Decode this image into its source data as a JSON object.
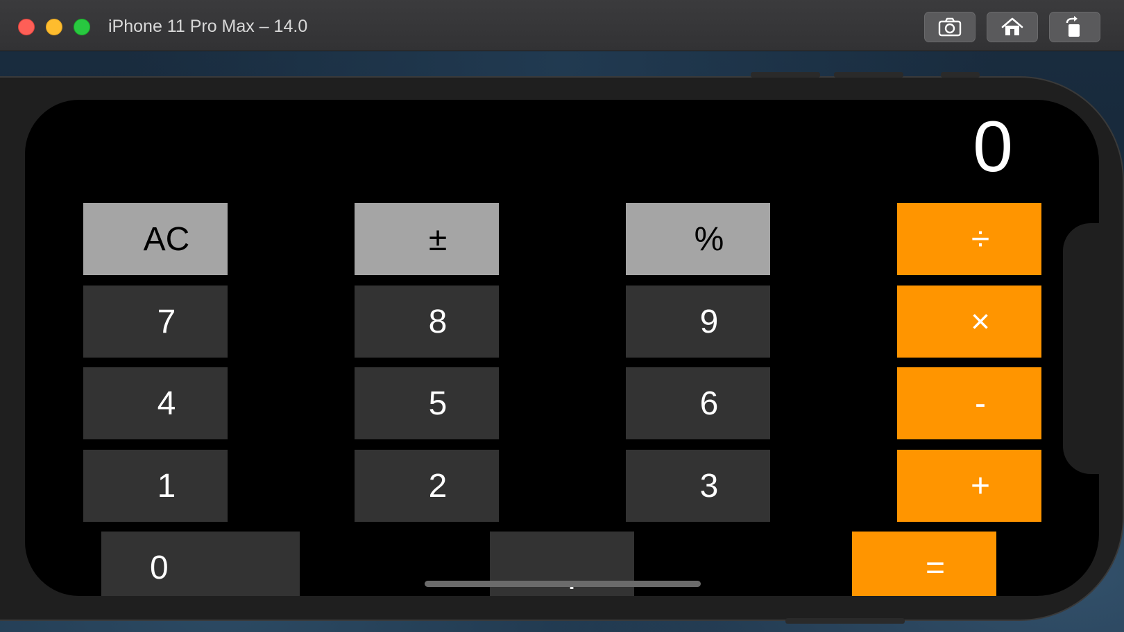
{
  "window": {
    "title": "iPhone 11 Pro Max – 14.0"
  },
  "toolbar": {
    "screenshot_icon": "camera-icon",
    "home_icon": "home-icon",
    "rotate_icon": "rotate-icon"
  },
  "calculator": {
    "display_value": "0",
    "rows": [
      [
        {
          "label": "AC",
          "kind": "func"
        },
        {
          "label": "±",
          "kind": "func"
        },
        {
          "label": "%",
          "kind": "func"
        },
        {
          "label": "÷",
          "kind": "op"
        }
      ],
      [
        {
          "label": "7",
          "kind": "num"
        },
        {
          "label": "8",
          "kind": "num"
        },
        {
          "label": "9",
          "kind": "num"
        },
        {
          "label": "×",
          "kind": "op"
        }
      ],
      [
        {
          "label": "4",
          "kind": "num"
        },
        {
          "label": "5",
          "kind": "num"
        },
        {
          "label": "6",
          "kind": "num"
        },
        {
          "label": "-",
          "kind": "op"
        }
      ],
      [
        {
          "label": "1",
          "kind": "num"
        },
        {
          "label": "2",
          "kind": "num"
        },
        {
          "label": "3",
          "kind": "num"
        },
        {
          "label": "+",
          "kind": "op"
        }
      ]
    ],
    "bottom_row": {
      "zero": "0",
      "decimal": ".",
      "equals": "="
    }
  },
  "colors": {
    "func_key": "#a5a5a5",
    "num_key": "#333333",
    "op_key": "#ff9500",
    "screen_bg": "#000000"
  }
}
